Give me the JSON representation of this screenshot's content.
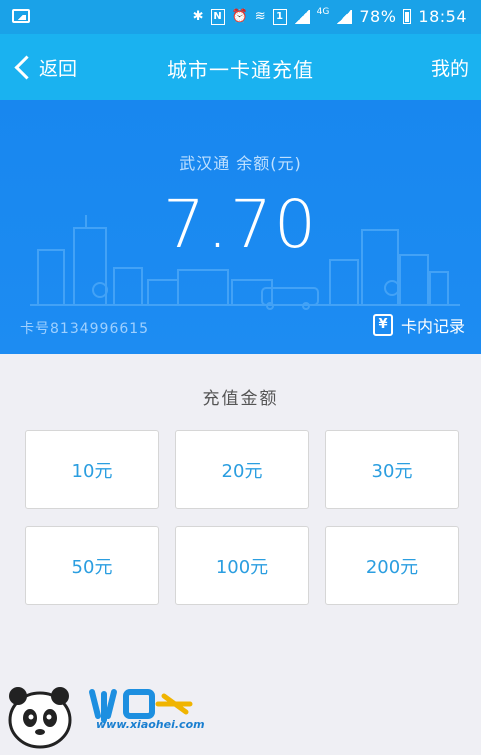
{
  "status_bar": {
    "network_label": "4G",
    "battery_percent": "78%",
    "time": "18:54",
    "icons": [
      "image-icon",
      "bluetooth-icon",
      "nfc-icon",
      "alarm-icon",
      "wifi-icon",
      "sim-icon",
      "signal-icon",
      "battery-icon"
    ]
  },
  "nav": {
    "back_label": "返回",
    "title": "城市一卡通充值",
    "right_label": "我的"
  },
  "card": {
    "balance_label": "武汉通 余额(元)",
    "balance": "7.70",
    "card_number": "卡号8134996615",
    "records_icon_glyph": "¥",
    "records_label": "卡内记录"
  },
  "recharge": {
    "title": "充值金额",
    "amounts": [
      "10元",
      "20元",
      "30元",
      "50元",
      "100元",
      "200元"
    ]
  },
  "watermark": {
    "url": "www.xiaohei.com"
  },
  "colors": {
    "nav_bg": "#1ab2f0",
    "card_bg": "#1887ef",
    "amount_text": "#2b9ee0",
    "page_bg": "#efeff4"
  }
}
